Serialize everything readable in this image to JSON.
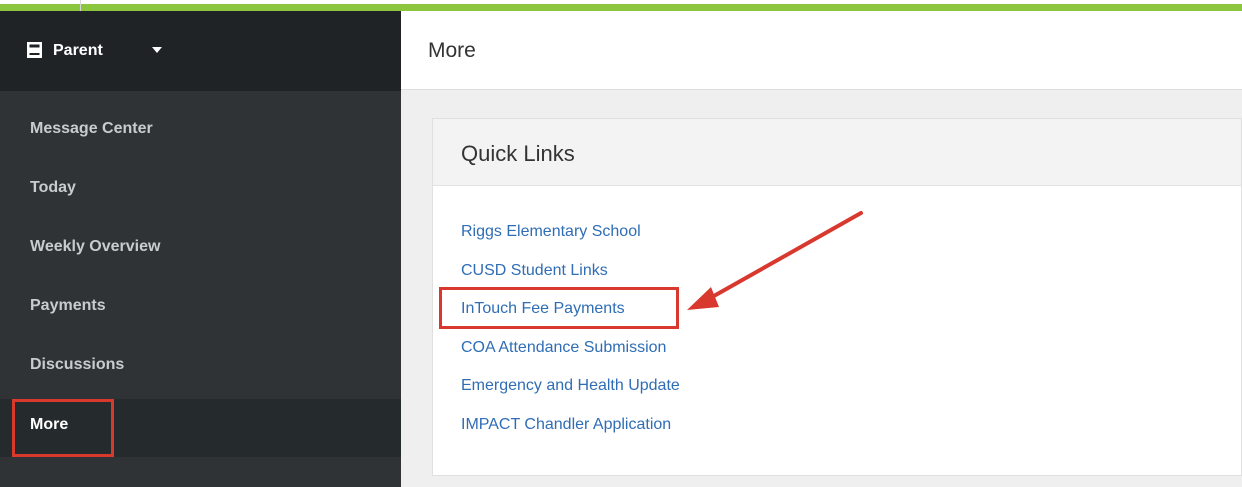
{
  "colors": {
    "accent_bar": "#8cc63f",
    "sidebar_bg": "#2f3336",
    "link": "#2f6db5",
    "annotation": "#d9382f"
  },
  "sidebar": {
    "role_label": "Parent",
    "role_icon": "book-icon",
    "items": [
      {
        "label": "Message Center"
      },
      {
        "label": "Today"
      },
      {
        "label": "Weekly Overview"
      },
      {
        "label": "Payments"
      },
      {
        "label": "Discussions"
      },
      {
        "label": "More",
        "active": true
      }
    ]
  },
  "main": {
    "title": "More",
    "quick_links": {
      "title": "Quick Links",
      "links": [
        "Riggs Elementary School",
        "CUSD Student Links",
        "InTouch Fee Payments",
        "COA Attendance Submission",
        "Emergency and Health Update",
        "IMPACT Chandler Application"
      ]
    }
  }
}
